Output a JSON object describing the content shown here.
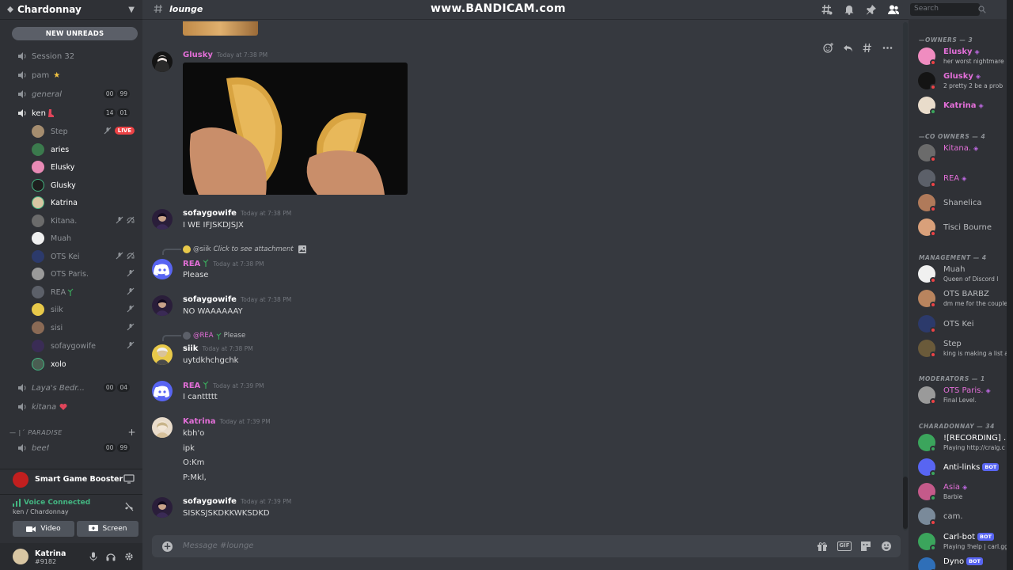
{
  "server": {
    "name": "Chardonnay",
    "new_unreads": "NEW UNREADS"
  },
  "channels": {
    "session32": "Session 32",
    "pam": "pam",
    "pam_emoji": "★",
    "general": "general",
    "general_counts": [
      "00",
      "99"
    ],
    "ken": "ken",
    "ken_counts": [
      "14",
      "01"
    ],
    "voice_users": [
      {
        "name": "Step",
        "live": "LIVE"
      },
      {
        "name": "aries"
      },
      {
        "name": "Elusky"
      },
      {
        "name": "Glusky"
      },
      {
        "name": "Katrina"
      },
      {
        "name": "Kitana."
      },
      {
        "name": "Muah"
      },
      {
        "name": "OTS Kei"
      },
      {
        "name": "OTS Paris."
      },
      {
        "name": "REA"
      },
      {
        "name": "siik"
      },
      {
        "name": "sisi"
      },
      {
        "name": "sofaygowife"
      },
      {
        "name": "xolo"
      }
    ],
    "layas": "Laya's Bedr...",
    "layas_counts": [
      "00",
      "04"
    ],
    "kitana": "kitana",
    "paradise_category": "PARADISE",
    "beef": "beef",
    "beef_counts": [
      "00",
      "99"
    ]
  },
  "game_booster": "Smart Game Booster",
  "voice": {
    "status": "Voice Connected",
    "sub": "ken / Chardonnay",
    "video": "Video",
    "screen": "Screen"
  },
  "user": {
    "name": "Katrina",
    "tag": "#9182"
  },
  "header": {
    "channel": "lounge",
    "watermark": "www.BANDICAM.com",
    "search_placeholder": "Search"
  },
  "messages": [
    {
      "author": "Glusky",
      "time": "Today at 7:38 PM",
      "color": "#e36fd8"
    },
    {
      "author": "sofaygowife",
      "time": "Today at 7:38 PM",
      "text": "I WE IFJSKDJSJX",
      "color": "#ffffff"
    },
    {
      "reply_to": "@siik",
      "reply_text": "Click to see attachment",
      "author": "REA",
      "time": "Today at 7:38 PM",
      "text": "Please",
      "color": "#e36fd8"
    },
    {
      "author": "sofaygowife",
      "time": "Today at 7:38 PM",
      "text": "NO WAAAAAAY",
      "color": "#ffffff"
    },
    {
      "reply_to": "@REA",
      "reply_text": "Please",
      "author": "siik",
      "time": "Today at 7:38 PM",
      "text": "uytdkhchgchk",
      "color": "#ffffff"
    },
    {
      "author": "REA",
      "time": "Today at 7:39 PM",
      "text": "I canttttt",
      "color": "#e36fd8"
    },
    {
      "author": "Katrina",
      "time": "Today at 7:39 PM",
      "lines": [
        "kbh'o",
        "ipk",
        "O:Km",
        "P:Mkl,"
      ],
      "color": "#e36fd8"
    },
    {
      "author": "sofaygowife",
      "time": "Today at 7:39 PM",
      "text": "SISKSJSKDKKWKSDKD",
      "color": "#ffffff"
    }
  ],
  "composer": {
    "placeholder": "Message #lounge",
    "gif": "GIF"
  },
  "members": {
    "owners_header": "—OWNERS — 3",
    "owners": [
      {
        "name": "Elusky",
        "sub": "her worst nightmare",
        "color": "#e36fd8"
      },
      {
        "name": "Glusky",
        "sub": "2 pretty 2 be a prob",
        "color": "#e36fd8"
      },
      {
        "name": "Katrina",
        "color": "#e36fd8"
      }
    ],
    "co_header": "—CO OWNERS — 4",
    "co_owners": [
      {
        "name": "Kitana.",
        "color": "#e36fd8"
      },
      {
        "name": "REA",
        "color": "#e36fd8"
      },
      {
        "name": "Shanelica",
        "color": "#b9bbbe"
      },
      {
        "name": "Tisci Bourne",
        "color": "#b9bbbe"
      }
    ],
    "mgmt_header": "MANAGEMENT — 4",
    "management": [
      {
        "name": "Muah",
        "sub": "Queen of Discord l",
        "color": "#b9bbbe"
      },
      {
        "name": "OTS BARBZ",
        "sub": "dm me for the couples",
        "color": "#b9bbbe"
      },
      {
        "name": "OTS Kei",
        "color": "#b9bbbe"
      },
      {
        "name": "Step",
        "sub": "king is making a list an",
        "color": "#b9bbbe"
      }
    ],
    "mod_header": "MODERATORS — 1",
    "moderators": [
      {
        "name": "OTS Paris.",
        "sub": "Final Level.",
        "color": "#e36fd8"
      }
    ],
    "char_header": "CHARADONNAY — 34",
    "charadonnay": [
      {
        "name": "![RECORDING] ..",
        "sub": "Playing http://craig.c",
        "color": "#ffffff"
      },
      {
        "name": "Anti-links",
        "bot": "BOT",
        "color": "#ffffff"
      },
      {
        "name": "Asia",
        "sub": "Barbie",
        "color": "#e36fd8"
      },
      {
        "name": "cam.",
        "color": "#b9bbbe"
      },
      {
        "name": "Carl-bot",
        "bot": "BOT",
        "sub": "Playing !help | carl.gg",
        "color": "#ffffff"
      },
      {
        "name": "Dyno",
        "bot": "BOT",
        "color": "#ffffff"
      }
    ]
  }
}
